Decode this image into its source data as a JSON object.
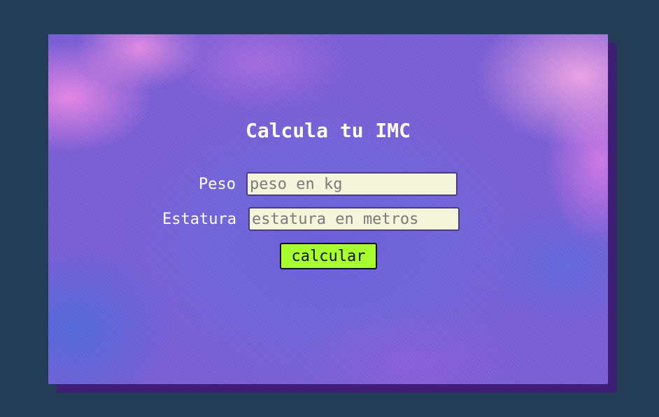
{
  "form": {
    "title": "Calcula tu IMC",
    "peso_label": "Peso",
    "peso_placeholder": "peso en kg",
    "estatura_label": "Estatura",
    "estatura_placeholder": "estatura en metros",
    "button_label": "calcular"
  },
  "colors": {
    "page_background": "#233d56",
    "card_shadow": "#3f1f75",
    "input_background": "#f5f5dc",
    "button_background": "#a8ff2e",
    "text": "#ffffff"
  }
}
